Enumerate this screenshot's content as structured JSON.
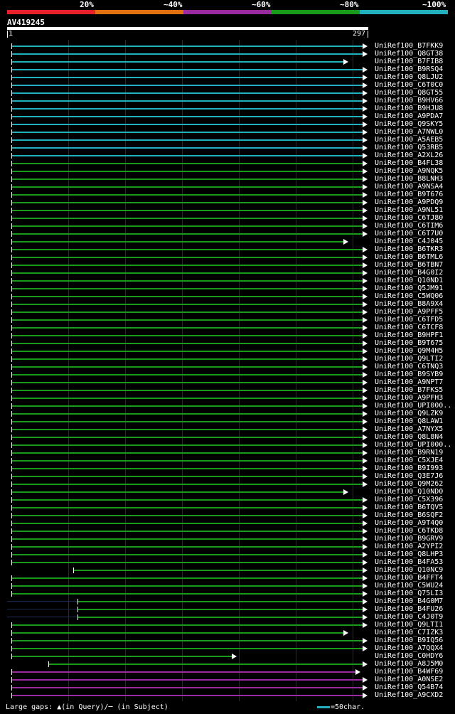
{
  "legend": {
    "labels": [
      "20%",
      "~40%",
      "~60%",
      "~80%",
      "~100%"
    ],
    "colors": [
      "#e8202a",
      "#e07010",
      "#9a2aa0",
      "#1a9a1a",
      "#20b0c0"
    ]
  },
  "query": {
    "name": "AV419245",
    "start": "1",
    "end": "297"
  },
  "hits": [
    {
      "id": "UniRef100_B7FKK9",
      "color": "cyan"
    },
    {
      "id": "UniRef100_Q8GT38",
      "color": "cyan"
    },
    {
      "id": "UniRef100_B7FIB8",
      "color": "cyan"
    },
    {
      "id": "UniRef100_B9RSQ4",
      "color": "cyan"
    },
    {
      "id": "UniRef100_Q8LJU2",
      "color": "cyan"
    },
    {
      "id": "UniRef100_C6T0C0",
      "color": "cyan"
    },
    {
      "id": "UniRef100_Q8GT55",
      "color": "cyan"
    },
    {
      "id": "UniRef100_B9HV66",
      "color": "cyan"
    },
    {
      "id": "UniRef100_B9HJU8",
      "color": "cyan"
    },
    {
      "id": "UniRef100_A9PDA7",
      "color": "cyan"
    },
    {
      "id": "UniRef100_Q9SKY5",
      "color": "cyan"
    },
    {
      "id": "UniRef100_A7NWL0",
      "color": "cyan"
    },
    {
      "id": "UniRef100_A5AEB5",
      "color": "cyan"
    },
    {
      "id": "UniRef100_Q53RB5",
      "color": "cyan"
    },
    {
      "id": "UniRef100_A2XL26",
      "color": "cyan"
    },
    {
      "id": "UniRef100_B4FL38",
      "color": "green"
    },
    {
      "id": "UniRef100_A9NQK5",
      "color": "green"
    },
    {
      "id": "UniRef100_B8LNH3",
      "color": "green"
    },
    {
      "id": "UniRef100_A9NSA4",
      "color": "green"
    },
    {
      "id": "UniRef100_B9T676",
      "color": "green"
    },
    {
      "id": "UniRef100_A9PDQ9",
      "color": "green"
    },
    {
      "id": "UniRef100_A9NL51",
      "color": "green"
    },
    {
      "id": "UniRef100_C6TJ80",
      "color": "green"
    },
    {
      "id": "UniRef100_C6TIM6",
      "color": "green"
    },
    {
      "id": "UniRef100_C6T7U0",
      "color": "green"
    },
    {
      "id": "UniRef100_C4J045",
      "color": "green"
    },
    {
      "id": "UniRef100_B6TKR3",
      "color": "green"
    },
    {
      "id": "UniRef100_B6TML6",
      "color": "green"
    },
    {
      "id": "UniRef100_B6TBN7",
      "color": "green"
    },
    {
      "id": "UniRef100_B4G0I2",
      "color": "green"
    },
    {
      "id": "UniRef100_Q10ND1",
      "color": "green"
    },
    {
      "id": "UniRef100_Q5JM91",
      "color": "green"
    },
    {
      "id": "UniRef100_C5WQ06",
      "color": "green"
    },
    {
      "id": "UniRef100_B8A9X4",
      "color": "green"
    },
    {
      "id": "UniRef100_A9PFF5",
      "color": "green"
    },
    {
      "id": "UniRef100_C6TFD5",
      "color": "green"
    },
    {
      "id": "UniRef100_C6TCF8",
      "color": "green"
    },
    {
      "id": "UniRef100_B9HPF1",
      "color": "green"
    },
    {
      "id": "UniRef100_B9T675",
      "color": "green"
    },
    {
      "id": "UniRef100_Q9M4H5",
      "color": "green"
    },
    {
      "id": "UniRef100_Q9LTI2",
      "color": "green"
    },
    {
      "id": "UniRef100_C6TNQ3",
      "color": "green"
    },
    {
      "id": "UniRef100_B9SYB9",
      "color": "green"
    },
    {
      "id": "UniRef100_A9NPT7",
      "color": "green"
    },
    {
      "id": "UniRef100_B7FKS5",
      "color": "green"
    },
    {
      "id": "UniRef100_A9PFH3",
      "color": "green"
    },
    {
      "id": "UniRef100_UPI000..",
      "color": "green"
    },
    {
      "id": "UniRef100_Q9LZK9",
      "color": "green"
    },
    {
      "id": "UniRef100_Q8LAW1",
      "color": "green"
    },
    {
      "id": "UniRef100_A7NYX5",
      "color": "green"
    },
    {
      "id": "UniRef100_Q8L8N4",
      "color": "green"
    },
    {
      "id": "UniRef100_UPI000..",
      "color": "green"
    },
    {
      "id": "UniRef100_B9RN19",
      "color": "green"
    },
    {
      "id": "UniRef100_C5XJE4",
      "color": "green"
    },
    {
      "id": "UniRef100_B9I993",
      "color": "green"
    },
    {
      "id": "UniRef100_Q3E7J6",
      "color": "green"
    },
    {
      "id": "UniRef100_Q9M262",
      "color": "green"
    },
    {
      "id": "UniRef100_Q10ND0",
      "color": "green"
    },
    {
      "id": "UniRef100_C5X396",
      "color": "green"
    },
    {
      "id": "UniRef100_B6TQV5",
      "color": "green"
    },
    {
      "id": "UniRef100_B6SQF2",
      "color": "green"
    },
    {
      "id": "UniRef100_A9T4Q0",
      "color": "green"
    },
    {
      "id": "UniRef100_C6TKD8",
      "color": "green"
    },
    {
      "id": "UniRef100_B9GRV9",
      "color": "green"
    },
    {
      "id": "UniRef100_A2YPI2",
      "color": "green"
    },
    {
      "id": "UniRef100_Q8LHP3",
      "color": "green"
    },
    {
      "id": "UniRef100_B4FA53",
      "color": "green"
    },
    {
      "id": "UniRef100_Q10NC9",
      "color": "green"
    },
    {
      "id": "UniRef100_B4FFT4",
      "color": "green"
    },
    {
      "id": "UniRef100_C5WU24",
      "color": "green"
    },
    {
      "id": "UniRef100_Q75LI3",
      "color": "green"
    },
    {
      "id": "UniRef100_B4G0M7",
      "color": "green"
    },
    {
      "id": "UniRef100_B4FU26",
      "color": "green"
    },
    {
      "id": "UniRef100_C4J0T9",
      "color": "green"
    },
    {
      "id": "UniRef100_Q9LTI1",
      "color": "green"
    },
    {
      "id": "UniRef100_C7IZK3",
      "color": "green"
    },
    {
      "id": "UniRef100_B9IQ56",
      "color": "green"
    },
    {
      "id": "UniRef100_A7QQX4",
      "color": "green"
    },
    {
      "id": "UniRef100_C0HDY6",
      "color": "green"
    },
    {
      "id": "UniRef100_A8J5M0",
      "color": "green"
    },
    {
      "id": "UniRef100_B4WF69",
      "color": "purple"
    },
    {
      "id": "UniRef100_A0NSE2",
      "color": "purple"
    },
    {
      "id": "UniRef100_Q54B74",
      "color": "purple"
    },
    {
      "id": "UniRef100_A9CXD2",
      "color": "purple"
    }
  ],
  "footer": {
    "gaps_text": "Large gaps: ▲(in Query)/─ (in Subject)",
    "scale_text": "=50char."
  }
}
